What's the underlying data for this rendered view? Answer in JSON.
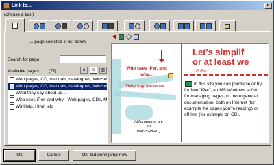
{
  "window": {
    "title": "Link to..."
  },
  "choose_label": "(choose a tab:)",
  "tabs": [
    {
      "icons": [
        "doc-icon"
      ],
      "active": true
    },
    {
      "icons": [
        "globe-icon",
        "book-icon"
      ]
    },
    {
      "icons": [
        "globe-icon",
        "disk-icon"
      ]
    },
    {
      "icons": [
        "globe-icon",
        "cd-icon"
      ]
    },
    {
      "icons": [
        "book-icon",
        "disk-icon"
      ]
    },
    {
      "icons": [
        "book-icon",
        "cd-icon"
      ]
    },
    {
      "icons": [
        "globe-icon",
        "book-icon"
      ]
    },
    {
      "icons": [
        "book-icon",
        "book-icon"
      ]
    },
    {
      "icons": [
        "book-icon",
        "book-icon"
      ]
    },
    {
      "icons": [
        "folder-icon"
      ]
    }
  ],
  "status_line": "... page selected in list below",
  "search": {
    "label": "Search for page:",
    "value": ""
  },
  "available": {
    "label": "Available pages:",
    "count": "(77)"
  },
  "pages": [
    {
      "label": "Web pages, CD, manuals, catalogues, WinHelp",
      "selected": false
    },
    {
      "label": "Web pages, CD, manuals, catalogues, WinHelp",
      "selected": true
    },
    {
      "label": "What they say about us...",
      "selected": false
    },
    {
      "label": "Who uses iPer, and why - Web pages, CDs, Ma",
      "selected": false
    },
    {
      "label": "WinHelp, HtmlHelp",
      "selected": false
    }
  ],
  "preview": {
    "link1_line1": "Who uses iPer, and",
    "link1_line2": "why...",
    "link2": "They say about us...",
    "note_line1": "(all programs are",
    "note_line2": "for",
    "note_line3": "Win95-98-NT)",
    "title_line1": "Let's simplif",
    "title_line2": "or at least we",
    "subtitle": "(? iPer)",
    "body": [
      "In this site you can purchase or try",
      "for free \"iPer\", an MS Windows softw",
      "for managing pages, or more general",
      "documentation, both on Internet (for",
      "example the pages you're reading) or",
      "off-line (for example on CD)."
    ]
  },
  "buttons": {
    "ok": "Ok",
    "cancel": "Cancel",
    "nojump": "Ok, but don't jump now"
  }
}
